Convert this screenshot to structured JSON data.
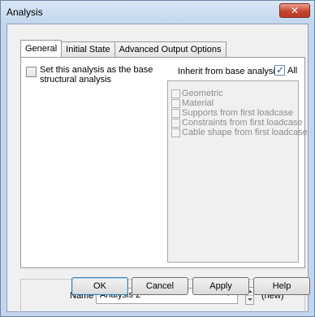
{
  "window": {
    "title": "Analysis",
    "close_symbol": "✕"
  },
  "tabs": [
    "General",
    "Initial State",
    "Advanced Output Options"
  ],
  "base_analysis": {
    "label": "Set this analysis as the base structural analysis",
    "checked": false
  },
  "inherit": {
    "label": "Inherit from base analysis",
    "all_label": "All",
    "all_checked": true,
    "items": [
      "Geometric",
      "Material",
      "Supports from first loadcase",
      "Constraints from first loadcase",
      "Cable shape from first loadcase"
    ]
  },
  "name_field": {
    "label": "Name",
    "value": "Analysis 2",
    "status": "(new)"
  },
  "buttons": {
    "ok": "OK",
    "cancel": "Cancel",
    "apply": "Apply",
    "help": "Help"
  }
}
